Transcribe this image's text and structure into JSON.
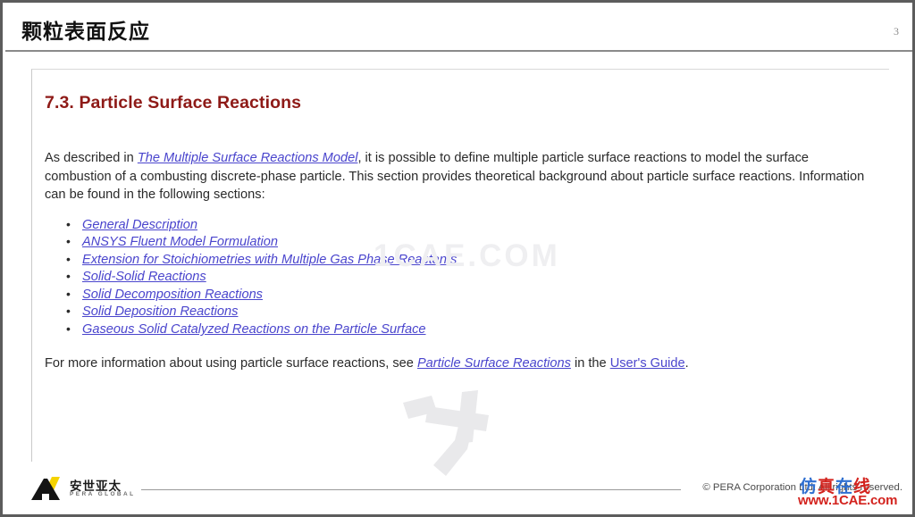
{
  "header": {
    "title": "颗粒表面反应",
    "page_number": "3"
  },
  "document": {
    "heading": "7.3. Particle Surface Reactions",
    "intro": {
      "part1": "As described in ",
      "link1": "The Multiple Surface Reactions Model",
      "part2": ", it is possible to define multiple particle surface reactions to model the surface combustion of a combusting discrete-phase particle. This section provides theoretical background about particle surface reactions. Information can be found in the following sections:"
    },
    "toc": [
      "General Description",
      "ANSYS Fluent Model Formulation",
      "Extension for Stoichiometries with Multiple Gas Phase Reactants",
      "Solid-Solid Reactions",
      "Solid Decomposition Reactions",
      "Solid Deposition Reactions",
      "Gaseous Solid Catalyzed Reactions on the Particle Surface"
    ],
    "closing": {
      "part1": "For more information about using particle surface reactions, see ",
      "link1": "Particle Surface Reactions",
      "part2": " in the ",
      "link2": "User's Guide",
      "part3": "."
    }
  },
  "watermarks": {
    "center_text": "1CAE.COM",
    "footer_cn_1": "仿",
    "footer_cn_2": "真",
    "footer_cn_3": "在",
    "footer_cn_4": "线",
    "footer_url": "www.1CAE.com"
  },
  "footer": {
    "logo_cn": "安世亚太",
    "logo_en": "PERA GLOBAL",
    "copyright": "© PERA Corporation Ltd. All rights reserved."
  },
  "colors": {
    "heading_red": "#8e1a17",
    "link_blue": "#4a45cd",
    "watermark_red": "#d3231e",
    "watermark_blue": "#2f6fd0",
    "logo_yellow": "#f5d300",
    "frame_gray": "#5c5c5c"
  }
}
